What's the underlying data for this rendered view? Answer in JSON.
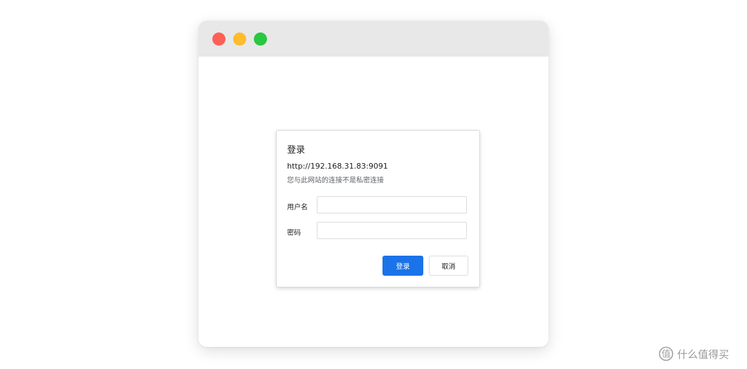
{
  "window": {
    "controls": {
      "close_icon": "close-traffic-light-icon",
      "minimize_icon": "minimize-traffic-light-icon",
      "maximize_icon": "maximize-traffic-light-icon",
      "colors": {
        "close": "#ff5f57",
        "minimize": "#febc2e",
        "maximize": "#28c840"
      }
    }
  },
  "dialog": {
    "title": "登录",
    "url": "http://192.168.31.83:9091",
    "warning": "您与此网站的连接不是私密连接",
    "username": {
      "label": "用户名",
      "value": "",
      "placeholder": ""
    },
    "password": {
      "label": "密码",
      "value": "",
      "placeholder": ""
    },
    "buttons": {
      "login": "登录",
      "cancel": "取消"
    },
    "accent_color": "#1a73e8"
  },
  "watermark": {
    "text": "什么值得买",
    "icon": "smzdm-logo-icon"
  }
}
